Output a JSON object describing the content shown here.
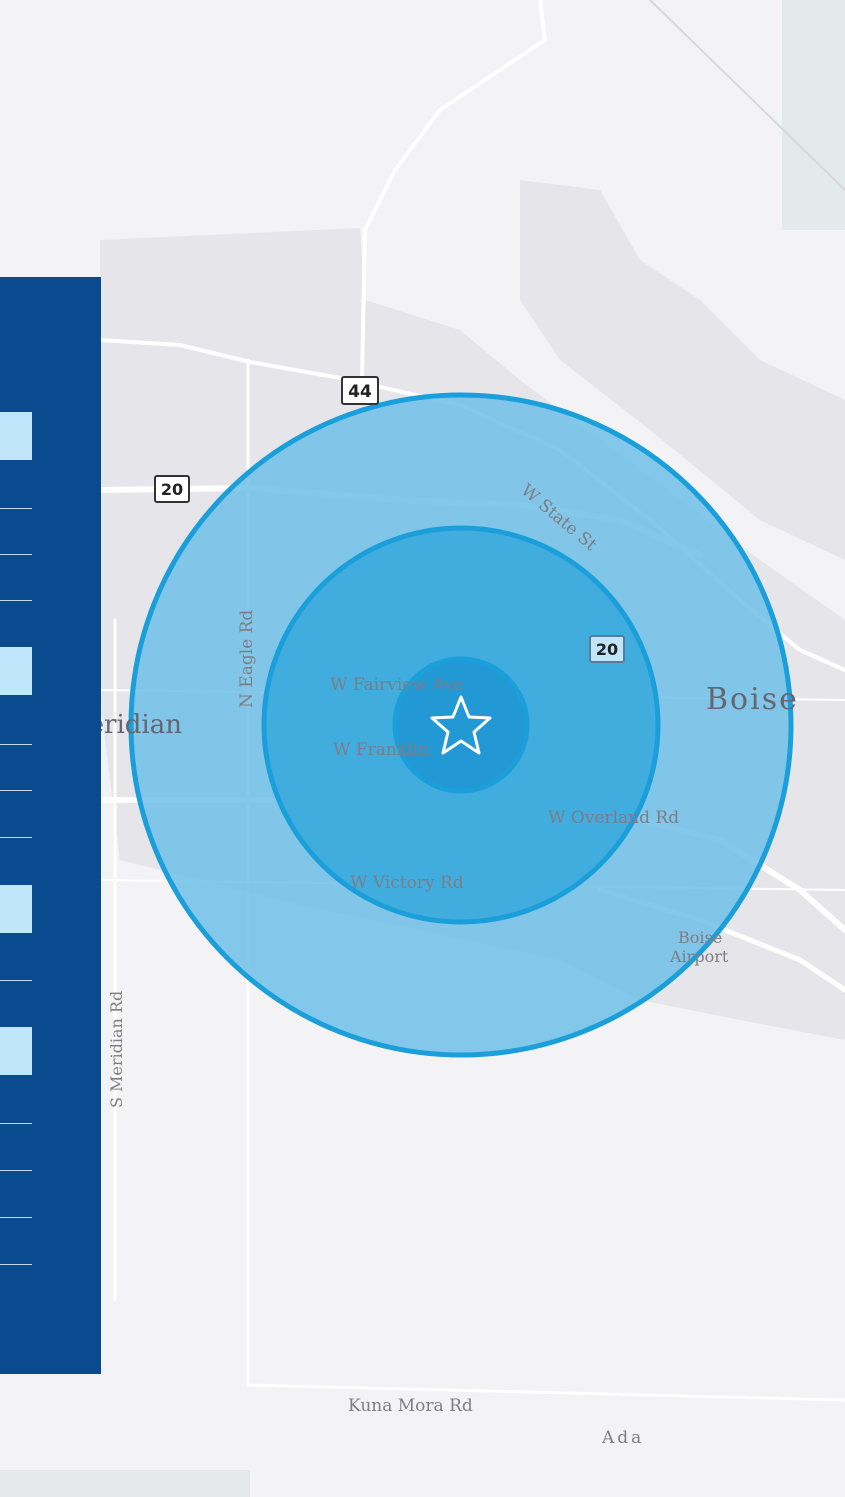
{
  "map": {
    "labels": {
      "w_state_st": "W State St",
      "n_eagle_rd": "N Eagle Rd",
      "w_fairview_ave": "W Fairview Ave",
      "w_franklin": "W Franklin",
      "w_overland_rd": "W Overland Rd",
      "w_victory_rd": "W Victory Rd",
      "s_meridian_rd": "S Meridian Rd",
      "kuna_mora_rd": "Kuna Mora Rd",
      "boise_airport_1": "Boise",
      "boise_airport_2": "Airport",
      "ada": "Ada"
    },
    "cities": {
      "meridian": "Meridian",
      "boise": "Boise"
    },
    "shields": {
      "hwy_44": "44",
      "hwy_20_west": "20",
      "hwy_20_east": "20"
    },
    "rings": [
      {
        "name": "outer-ring",
        "fill": "#6fc0e8",
        "stroke": "#1a9fda"
      },
      {
        "name": "middle-ring",
        "fill": "#3aa8dd",
        "stroke": "#1a9fda"
      },
      {
        "name": "inner-ring",
        "fill": "#2299d5",
        "stroke": "#1a9fda"
      }
    ],
    "center_marker": "star-icon"
  },
  "panel": {
    "background": "#0a4a8f",
    "highlight": "#bfe6fb"
  }
}
